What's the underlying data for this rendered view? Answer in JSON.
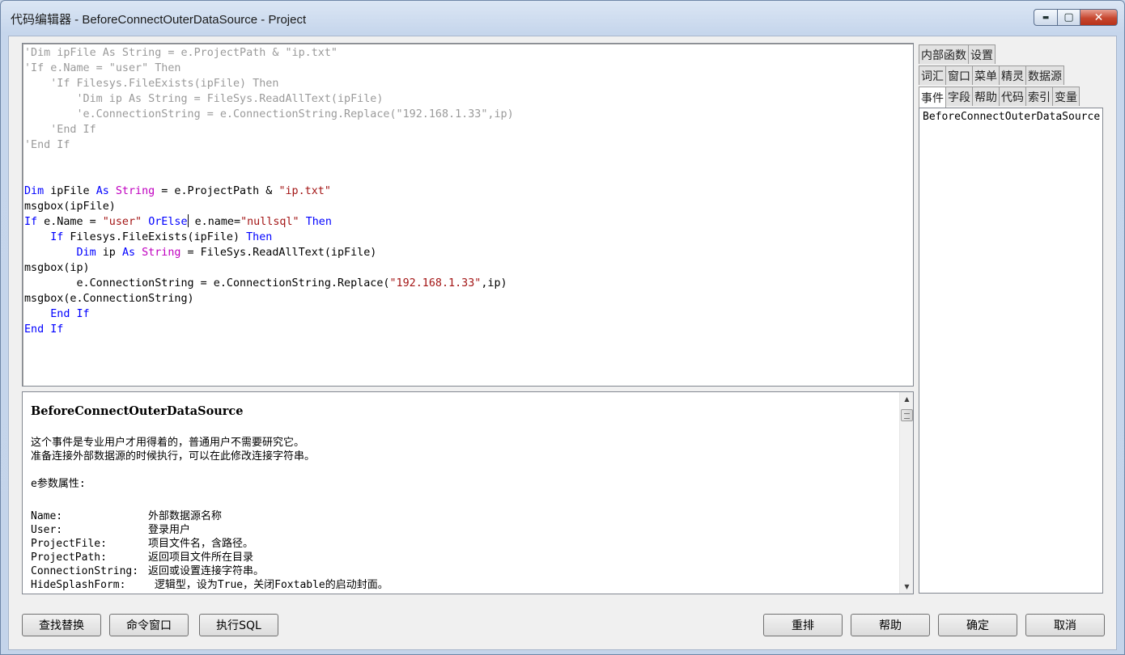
{
  "window": {
    "title": "代码编辑器 - BeforeConnectOuterDataSource - Project",
    "minimize": "▬",
    "maximize": "▢",
    "close": "✕"
  },
  "editor": {
    "lines": [
      [
        {
          "t": "'Dim ipFile As String = e.ProjectPath & \"ip.txt\"",
          "c": "cm"
        }
      ],
      [
        {
          "t": "'If e.Name = \"user\" Then",
          "c": "cm"
        }
      ],
      [
        {
          "t": "    'If Filesys.FileExists(ipFile) Then",
          "c": "cm"
        }
      ],
      [
        {
          "t": "        'Dim ip As String = FileSys.ReadAllText(ipFile)",
          "c": "cm"
        }
      ],
      [
        {
          "t": "        'e.ConnectionString = e.ConnectionString.Replace(\"192.168.1.33\",ip)",
          "c": "cm"
        }
      ],
      [
        {
          "t": "    'End If",
          "c": "cm"
        }
      ],
      [
        {
          "t": "'End If",
          "c": "cm"
        }
      ],
      [],
      [],
      [
        {
          "t": "Dim",
          "c": "kw"
        },
        {
          "t": " ipFile "
        },
        {
          "t": "As",
          "c": "kw"
        },
        {
          "t": " "
        },
        {
          "t": "String",
          "c": "ty"
        },
        {
          "t": " = e.ProjectPath & "
        },
        {
          "t": "\"ip.txt\"",
          "c": "st"
        }
      ],
      [
        {
          "t": "msgbox(ipFile)"
        }
      ],
      [
        {
          "t": "If",
          "c": "kw"
        },
        {
          "t": " e.Name = "
        },
        {
          "t": "\"user\"",
          "c": "st"
        },
        {
          "t": " "
        },
        {
          "t": "OrElse",
          "c": "kw"
        },
        {
          "t": "",
          "c": "caret"
        },
        {
          "t": " e.name="
        },
        {
          "t": "\"nullsql\"",
          "c": "st"
        },
        {
          "t": " "
        },
        {
          "t": "Then",
          "c": "kw"
        }
      ],
      [
        {
          "t": "    "
        },
        {
          "t": "If",
          "c": "kw"
        },
        {
          "t": " Filesys.FileExists(ipFile) "
        },
        {
          "t": "Then",
          "c": "kw"
        }
      ],
      [
        {
          "t": "        "
        },
        {
          "t": "Dim",
          "c": "kw"
        },
        {
          "t": " ip "
        },
        {
          "t": "As",
          "c": "kw"
        },
        {
          "t": " "
        },
        {
          "t": "String",
          "c": "ty"
        },
        {
          "t": " = FileSys.ReadAllText(ipFile)"
        }
      ],
      [
        {
          "t": "msgbox(ip)"
        }
      ],
      [
        {
          "t": "        e.ConnectionString = e.ConnectionString.Replace("
        },
        {
          "t": "\"192.168.1.33\"",
          "c": "st"
        },
        {
          "t": ",ip)"
        }
      ],
      [
        {
          "t": "msgbox(e.ConnectionString)"
        }
      ],
      [
        {
          "t": "    "
        },
        {
          "t": "End If",
          "c": "kw"
        }
      ],
      [
        {
          "t": "End If",
          "c": "kw"
        }
      ]
    ]
  },
  "help": {
    "title": "BeforeConnectOuterDataSource",
    "para1": "这个事件是专业用户才用得着的，普通用户不需要研究它。",
    "para2": "准备连接外部数据源的时候执行，可以在此修改连接字符串。",
    "props_heading": "e参数属性:",
    "props": [
      {
        "name": "Name:",
        "desc": "外部数据源名称"
      },
      {
        "name": "User:",
        "desc": "登录用户"
      },
      {
        "name": "ProjectFile:",
        "desc": "项目文件名，含路径。"
      },
      {
        "name": "ProjectPath:",
        "desc": "返回项目文件所在目录"
      },
      {
        "name": "ConnectionString:",
        "desc": "返回或设置连接字符串。"
      },
      {
        "name": "HideSplashForm:",
        "desc": " 逻辑型，设为True，关闭Foxtable的启动封面。"
      }
    ],
    "scroll_up": "▲",
    "scroll_down": "▼"
  },
  "tabs": {
    "row1": [
      "内部函数",
      "设置"
    ],
    "row2": [
      "词汇",
      "窗口",
      "菜单",
      "精灵",
      "数据源"
    ],
    "row3": [
      "事件",
      "字段",
      "帮助",
      "代码",
      "索引",
      "变量"
    ],
    "active": "事件"
  },
  "event_list": {
    "items": [
      "BeforeConnectOuterDataSource"
    ]
  },
  "buttons": {
    "find_replace": "查找替换",
    "command_window": "命令窗口",
    "exec_sql": "执行SQL",
    "rearrange": "重排",
    "help": "帮助",
    "ok": "确定",
    "cancel": "取消"
  }
}
